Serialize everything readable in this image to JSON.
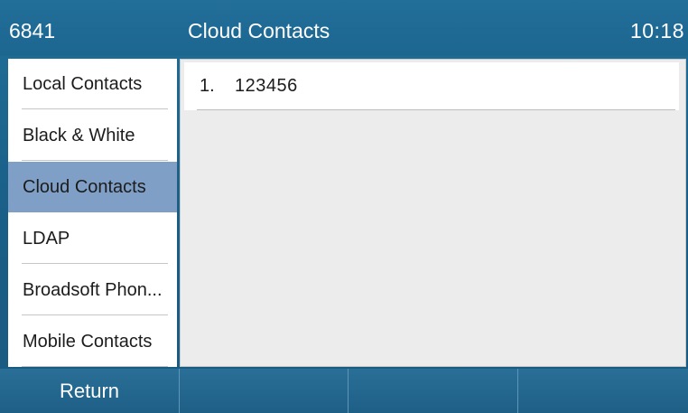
{
  "titlebar": {
    "extension": "6841",
    "title": "Cloud Contacts",
    "time": "10:18"
  },
  "sidebar": {
    "items": [
      {
        "label": "Local Contacts",
        "active": false
      },
      {
        "label": "Black & White",
        "active": false
      },
      {
        "label": "Cloud Contacts",
        "active": true
      },
      {
        "label": "LDAP",
        "active": false
      },
      {
        "label": "Broadsoft Phon...",
        "active": false
      },
      {
        "label": "Mobile Contacts",
        "active": false
      }
    ]
  },
  "content": {
    "rows": [
      {
        "index": "1.",
        "value": "123456"
      }
    ]
  },
  "softkeys": [
    {
      "label": "Return"
    },
    {
      "label": ""
    },
    {
      "label": ""
    },
    {
      "label": ""
    }
  ],
  "colors": {
    "titlebar": "#1c6690",
    "active_item": "#7f9fc6",
    "content_bg": "#ececec",
    "softkey": "#1e5f86"
  }
}
